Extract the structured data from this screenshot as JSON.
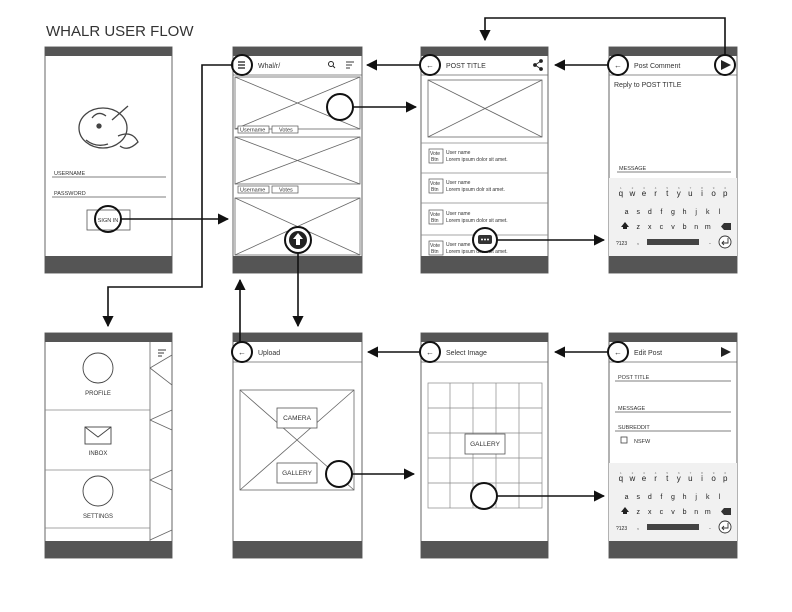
{
  "title": "WHALR USER FLOW",
  "login": {
    "username_label": "USERNAME",
    "password_label": "PASSWORD",
    "signin_label": "SIGN IN"
  },
  "feed": {
    "title": "Whal/r/",
    "posts": [
      {
        "username": "Username",
        "votes": "Votes"
      },
      {
        "username": "Username",
        "votes": "Votes"
      }
    ]
  },
  "post": {
    "title": "POST TITLE",
    "comments": [
      {
        "vote": "Vote",
        "btn": "Btn",
        "username": "User name",
        "text": "Lorem ipsum dolor sit amet."
      },
      {
        "vote": "Vote",
        "btn": "Btn",
        "username": "User name",
        "text": "Lorem ipsum dolr sit amet."
      },
      {
        "vote": "Vote",
        "btn": "Btn",
        "username": "User name",
        "text": "Lorem ipsum dolor sit amet."
      },
      {
        "vote": "Vote",
        "btn": "Btn",
        "username": "User name",
        "text": "Lorem ipsum dolor sit amet."
      }
    ]
  },
  "post_comment": {
    "title": "Post Comment",
    "reply_to": "Reply to POST TITLE",
    "message_label": "MESSAGE"
  },
  "keyboard": {
    "row1": [
      "q",
      "w",
      "e",
      "r",
      "t",
      "y",
      "u",
      "i",
      "o",
      "p"
    ],
    "row1_num": [
      "1",
      "2",
      "3",
      "4",
      "5",
      "6",
      "7",
      "8",
      "9",
      "0"
    ],
    "row2": [
      "a",
      "s",
      "d",
      "f",
      "g",
      "h",
      "j",
      "k",
      "l"
    ],
    "row3": [
      "z",
      "x",
      "c",
      "v",
      "b",
      "n",
      "m"
    ],
    "sym_key": "?123",
    "comma_key": ",",
    "period_key": "."
  },
  "menu": {
    "items": [
      {
        "label": "PROFILE",
        "icon": "circle-icon"
      },
      {
        "label": "INBOX",
        "icon": "envelope-icon"
      },
      {
        "label": "SETTINGS",
        "icon": "circle-icon"
      }
    ]
  },
  "upload": {
    "title": "Upload",
    "camera_label": "CAMERA",
    "gallery_label": "GALLERY"
  },
  "select_image": {
    "title": "Select Image",
    "gallery_label": "GALLERY"
  },
  "edit_post": {
    "title": "Edit Post",
    "post_title_label": "POST TITLE",
    "message_label": "MESSAGE",
    "subreddit_label": "SUBREDDIT",
    "nsfw_label": "NSFW"
  }
}
